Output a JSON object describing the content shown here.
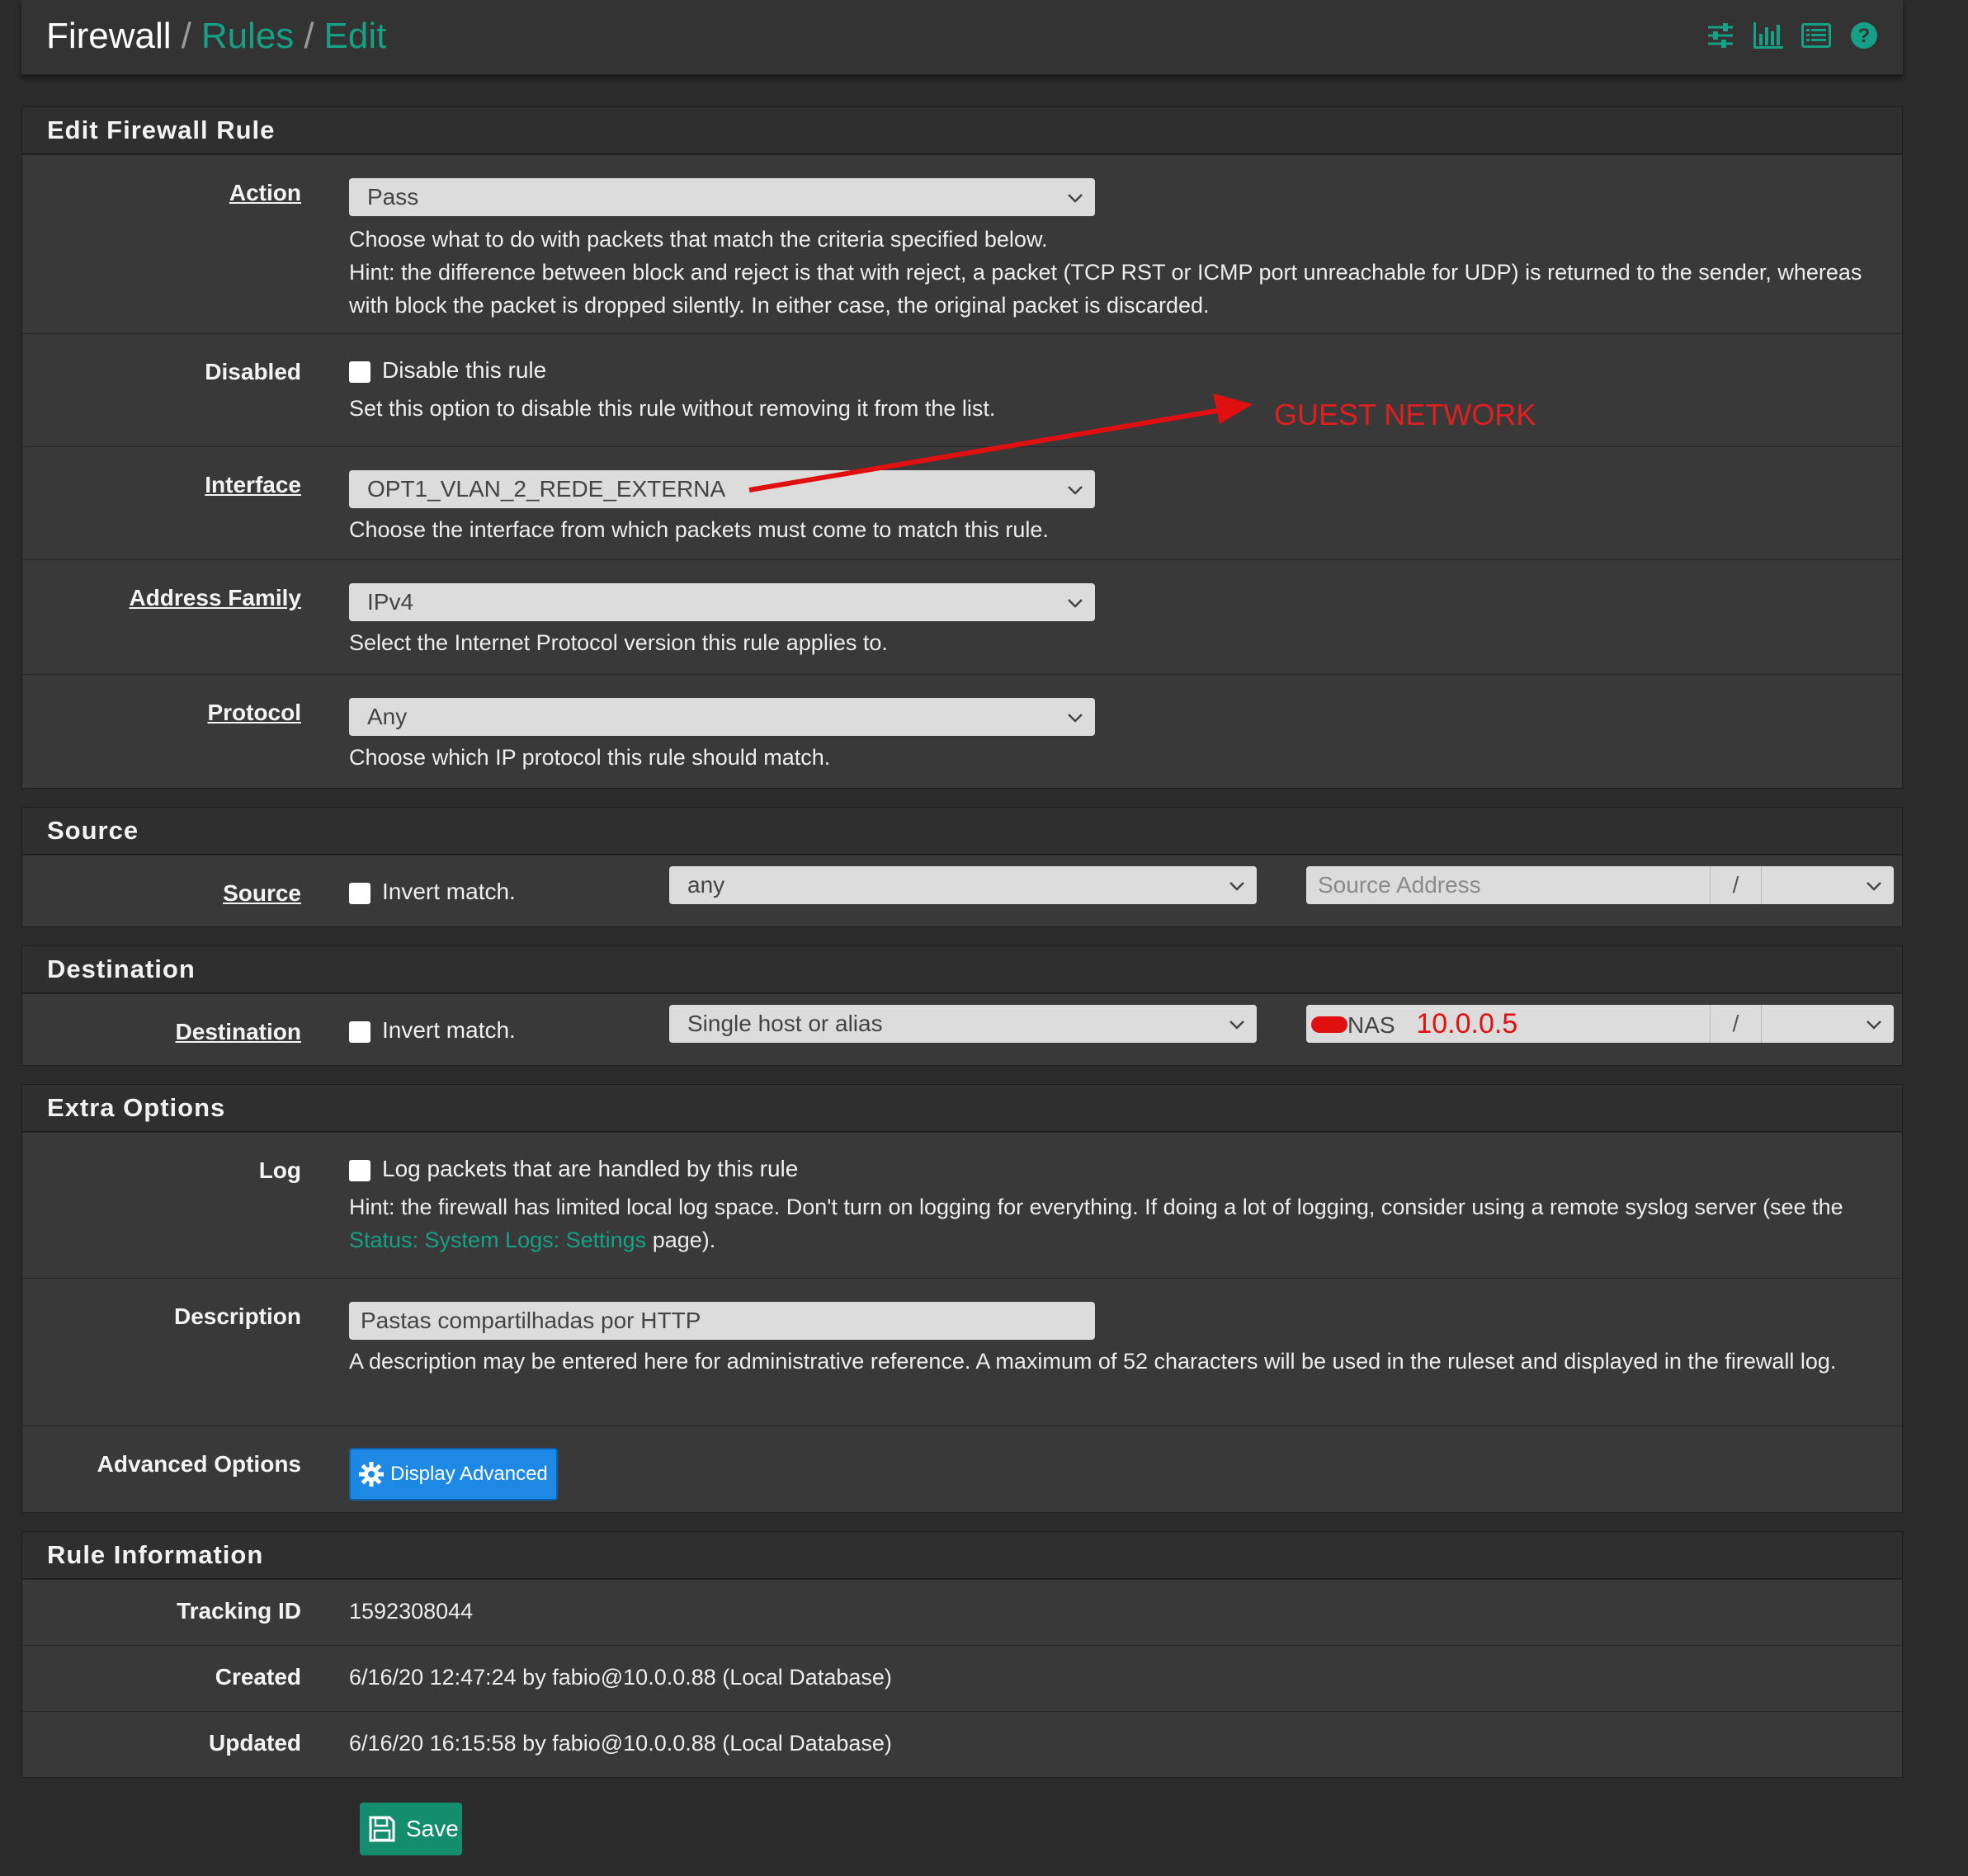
{
  "breadcrumb": {
    "home": "Firewall",
    "sep1": "/",
    "rules": "Rules",
    "sep2": "/",
    "current": "Edit"
  },
  "header_icons": [
    "sliders-icon",
    "bar-chart-icon",
    "list-icon",
    "help-icon"
  ],
  "edit_rule": {
    "title": "Edit Firewall Rule",
    "action": {
      "label": "Action",
      "value": "Pass",
      "help1": "Choose what to do with packets that match the criteria specified below.",
      "help2": "Hint: the difference between block and reject is that with reject, a packet (TCP RST or ICMP port unreachable for UDP) is returned to the sender, whereas with block the packet is dropped silently. In either case, the original packet is discarded."
    },
    "disabled": {
      "label": "Disabled",
      "checkbox_label": "Disable this rule",
      "help": "Set this option to disable this rule without removing it from the list."
    },
    "interface": {
      "label": "Interface",
      "value": "OPT1_VLAN_2_REDE_EXTERNA",
      "help": "Choose the interface from which packets must come to match this rule."
    },
    "address_family": {
      "label": "Address Family",
      "value": "IPv4",
      "help": "Select the Internet Protocol version this rule applies to."
    },
    "protocol": {
      "label": "Protocol",
      "value": "Any",
      "help": "Choose which IP protocol this rule should match."
    }
  },
  "annotation": {
    "text": "GUEST NETWORK",
    "color": "#e02020"
  },
  "source": {
    "title": "Source",
    "label": "Source",
    "invert_label": "Invert match.",
    "type_value": "any",
    "address_placeholder": "Source Address",
    "slash": "/"
  },
  "destination": {
    "title": "Destination",
    "label": "Destination",
    "invert_label": "Invert match.",
    "type_value": "Single host or alias",
    "address_value": "NAS",
    "address_annotation": "10.0.0.5",
    "slash": "/"
  },
  "extra": {
    "title": "Extra Options",
    "log": {
      "label": "Log",
      "checkbox_label": "Log packets that are handled by this rule",
      "help_before": "Hint: the firewall has limited local log space. Don't turn on logging for everything. If doing a lot of logging, consider using a remote syslog server (see the ",
      "help_link": "Status: System Logs: Settings",
      "help_after": " page)."
    },
    "description": {
      "label": "Description",
      "value": "Pastas compartilhadas por HTTP",
      "help": "A description may be entered here for administrative reference. A maximum of 52 characters will be used in the ruleset and displayed in the firewall log."
    },
    "advanced": {
      "label": "Advanced Options",
      "button": "Display Advanced"
    }
  },
  "info": {
    "title": "Rule Information",
    "tracking": {
      "label": "Tracking ID",
      "value": "1592308044"
    },
    "created": {
      "label": "Created",
      "value": "6/16/20 12:47:24 by fabio@10.0.0.88 (Local Database)"
    },
    "updated": {
      "label": "Updated",
      "value": "6/16/20 16:15:58 by fabio@10.0.0.88 (Local Database)"
    }
  },
  "save_button": "Save",
  "colors": {
    "accent": "#16a085",
    "save": "#148c6e",
    "advanced": "#1e88e5",
    "annotation": "#e02020"
  }
}
